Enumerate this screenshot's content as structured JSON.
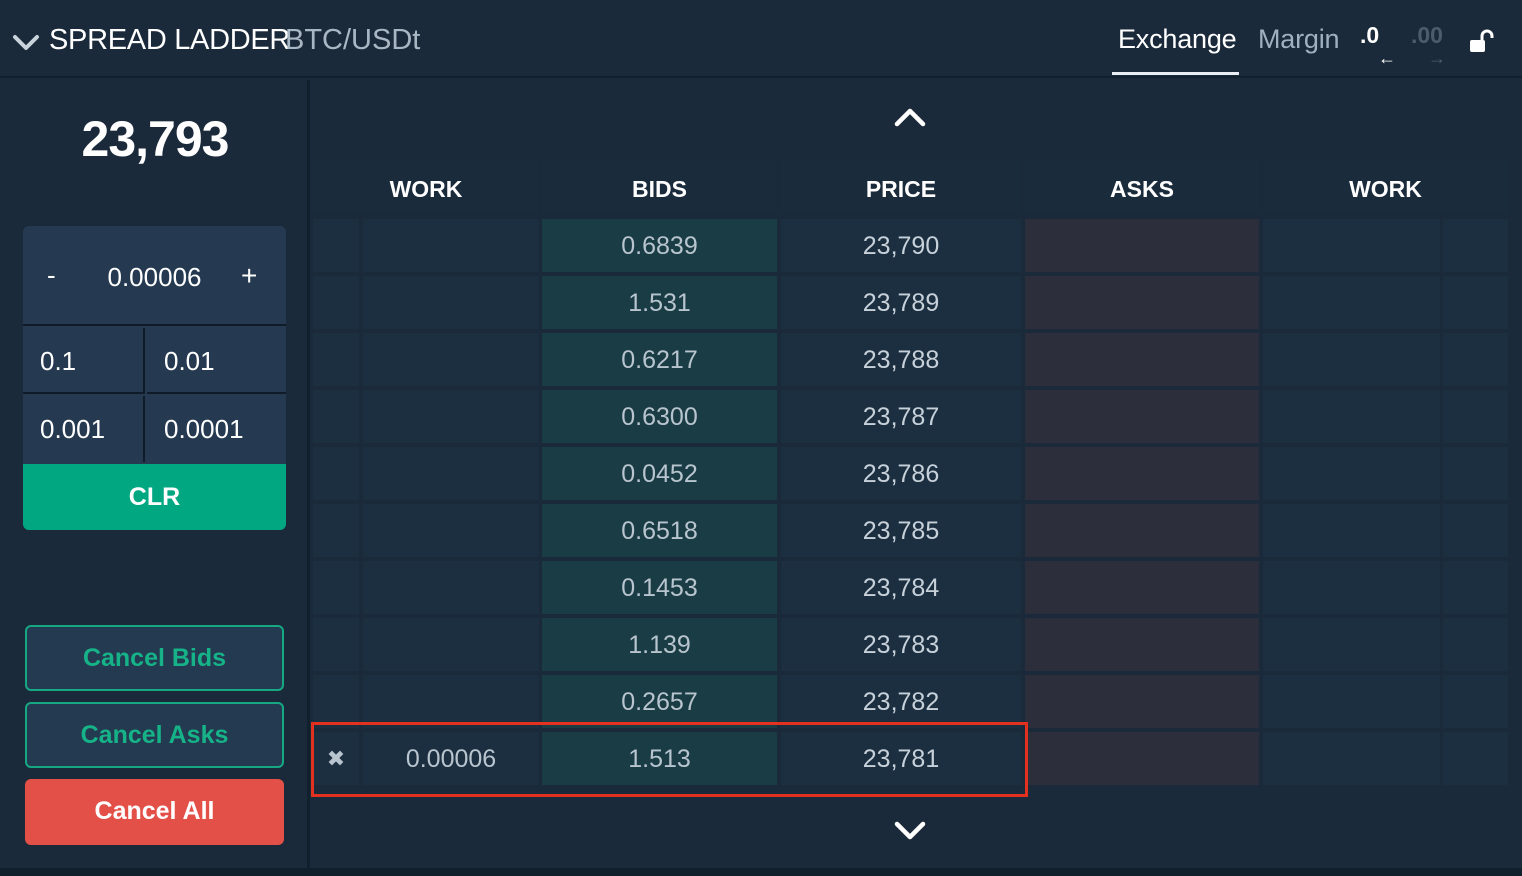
{
  "header": {
    "title": "SPREAD LADDER",
    "pair": "BTC/USDt",
    "tabs": [
      {
        "label": "Exchange",
        "active": true
      },
      {
        "label": "Margin",
        "active": false
      }
    ],
    "precision_decrease": ".0",
    "precision_increase": ".00",
    "precision_decrease_arrow": "←",
    "precision_increase_arrow": "→",
    "lock_icon": "unlock-icon"
  },
  "left": {
    "last_price": "23,793",
    "quantity": {
      "minus_label": "-",
      "value": "0.00006",
      "plus_label": "+"
    },
    "increments": [
      "0.1",
      "0.01",
      "0.001",
      "0.0001"
    ],
    "clr_label": "CLR",
    "cancel_bids_label": "Cancel Bids",
    "cancel_asks_label": "Cancel Asks",
    "cancel_all_label": "Cancel All"
  },
  "ladder": {
    "columns": [
      "WORK",
      "BIDS",
      "PRICE",
      "ASKS",
      "WORK"
    ],
    "rows": [
      {
        "cancel": "",
        "work_bid": "",
        "bid": "0.6839",
        "price": "23,790",
        "ask": "",
        "work_ask": ""
      },
      {
        "cancel": "",
        "work_bid": "",
        "bid": "1.531",
        "price": "23,789",
        "ask": "",
        "work_ask": ""
      },
      {
        "cancel": "",
        "work_bid": "",
        "bid": "0.6217",
        "price": "23,788",
        "ask": "",
        "work_ask": ""
      },
      {
        "cancel": "",
        "work_bid": "",
        "bid": "0.6300",
        "price": "23,787",
        "ask": "",
        "work_ask": ""
      },
      {
        "cancel": "",
        "work_bid": "",
        "bid": "0.0452",
        "price": "23,786",
        "ask": "",
        "work_ask": ""
      },
      {
        "cancel": "",
        "work_bid": "",
        "bid": "0.6518",
        "price": "23,785",
        "ask": "",
        "work_ask": ""
      },
      {
        "cancel": "",
        "work_bid": "",
        "bid": "0.1453",
        "price": "23,784",
        "ask": "",
        "work_ask": ""
      },
      {
        "cancel": "",
        "work_bid": "",
        "bid": "1.139",
        "price": "23,783",
        "ask": "",
        "work_ask": ""
      },
      {
        "cancel": "",
        "work_bid": "",
        "bid": "0.2657",
        "price": "23,782",
        "ask": "",
        "work_ask": ""
      },
      {
        "cancel": "✖",
        "work_bid": "0.00006",
        "bid": "1.513",
        "price": "23,781",
        "ask": "",
        "work_ask": ""
      }
    ]
  },
  "colors": {
    "background": "#1b2a3a",
    "accent_green": "#01a781",
    "cancel_all_red": "#e35048",
    "highlight_red": "#e2311f",
    "bid_cell": "#1a3c44",
    "ask_cell": "#2c2e3c"
  }
}
